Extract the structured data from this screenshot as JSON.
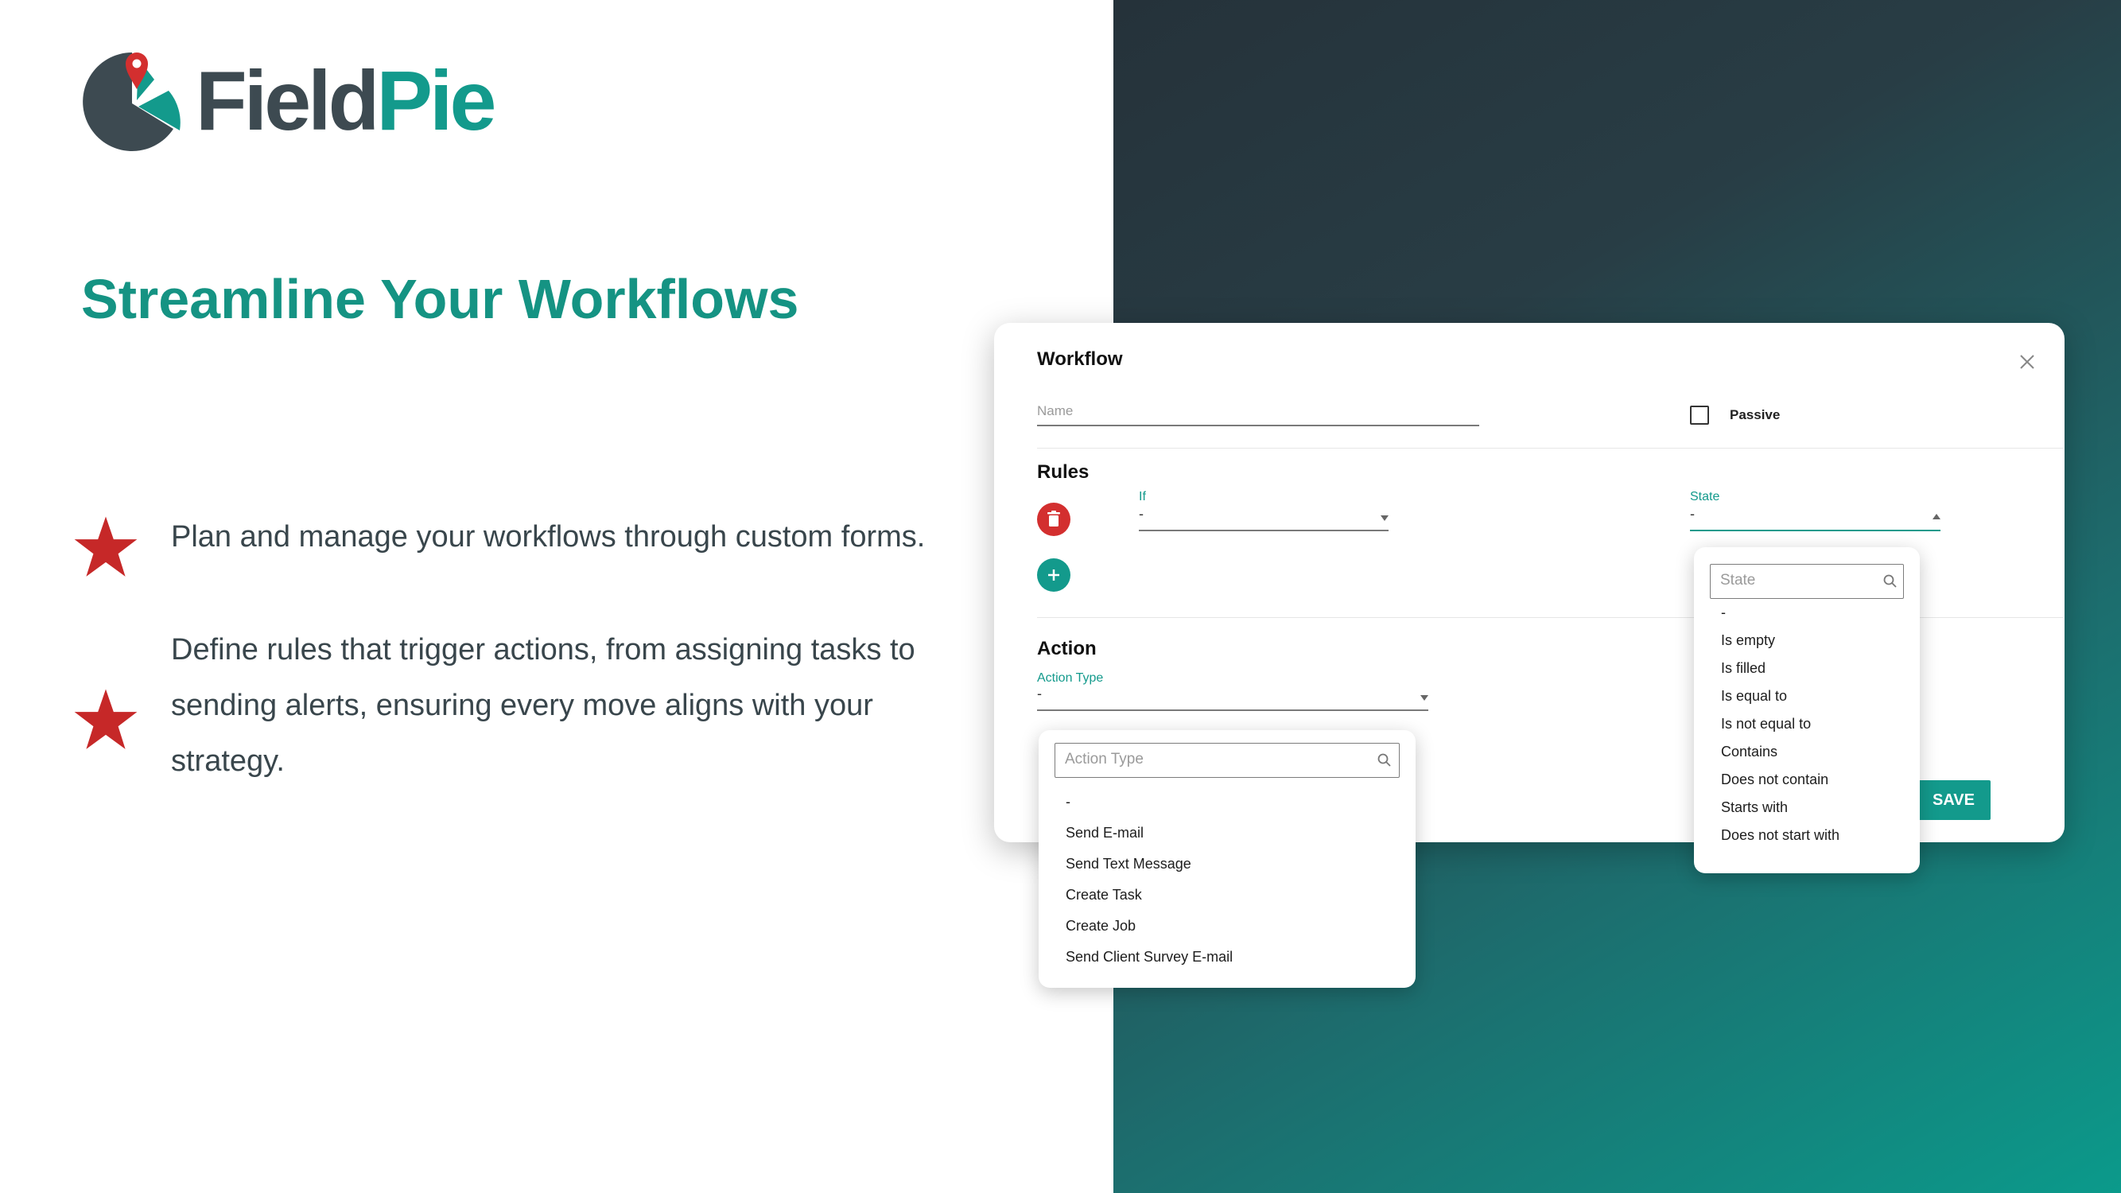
{
  "brand": {
    "name_part1": "Field",
    "name_part2": "Pie",
    "teal": "#139a8c",
    "dark": "#3d4a51"
  },
  "headline": "Streamline Your Workflows",
  "bullets": [
    "Plan and manage your workflows through custom forms.",
    "Define rules that trigger actions, from assigning tasks to sending alerts, ensuring every move aligns with your strategy."
  ],
  "dialog": {
    "title": "Workflow",
    "close_icon": "close-icon",
    "name_placeholder": "Name",
    "passive_label": "Passive",
    "rules_title": "Rules",
    "if_label": "If",
    "if_value": "-",
    "state_label": "State",
    "state_value": "-",
    "action_title": "Action",
    "action_type_label": "Action Type",
    "action_type_value": "-",
    "save_label": "SAVE"
  },
  "state_dropdown": {
    "search_placeholder": "State",
    "options": [
      "-",
      "Is empty",
      "Is filled",
      "Is equal to",
      "Is not equal to",
      "Contains",
      "Does not contain",
      "Starts with",
      "Does not start with"
    ]
  },
  "action_dropdown": {
    "search_placeholder": "Action Type",
    "options": [
      "-",
      "Send E-mail",
      "Send Text Message",
      "Create Task",
      "Create Job",
      "Send Client Survey E-mail"
    ]
  },
  "colors": {
    "star": "#c62828",
    "delete": "#d32f2f",
    "add": "#139a8c"
  }
}
